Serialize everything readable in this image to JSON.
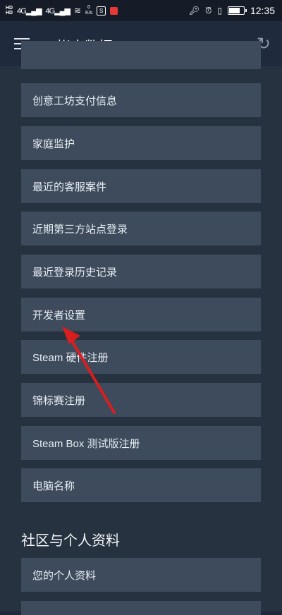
{
  "status_bar": {
    "sim1": "HD",
    "sim2": "HD",
    "signal1": "4G",
    "signal2": "4G",
    "speed_value": "0",
    "speed_unit": "K/s",
    "time": "12:35"
  },
  "app_bar": {
    "title": "帐户数据"
  },
  "items": [
    {
      "label": "创意工坊支付信息"
    },
    {
      "label": "家庭监护"
    },
    {
      "label": "最近的客服案件"
    },
    {
      "label": "近期第三方站点登录"
    },
    {
      "label": "最近登录历史记录"
    },
    {
      "label": "开发者设置"
    },
    {
      "label": "Steam 硬件注册"
    },
    {
      "label": "锦标赛注册"
    },
    {
      "label": "Steam Box 测试版注册"
    },
    {
      "label": "电脑名称"
    }
  ],
  "section2": {
    "title": "社区与个人资料",
    "items": [
      {
        "label": "您的个人资料"
      }
    ]
  },
  "colors": {
    "background": "#26323f",
    "item_bg": "#3d4b5c",
    "annotation_arrow": "#d81e1e"
  }
}
